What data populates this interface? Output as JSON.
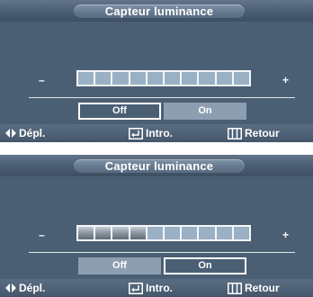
{
  "colors": {
    "panel": "#4b5f74",
    "title_pill": "#66798f",
    "footer": "#4d6075",
    "bar_empty_segment": "#9ab0c4",
    "bar_filled_segment": "#7d8893",
    "unselected_option": "#8c9eb0",
    "text": "#ffffff"
  },
  "menus": [
    {
      "title": "Capteur luminance",
      "minus_label": "–",
      "plus_label": "+",
      "level": {
        "filled_segments": 0,
        "total_segments": 10
      },
      "options": [
        {
          "label": "Off",
          "selected": true
        },
        {
          "label": "On",
          "selected": false
        }
      ],
      "footer": {
        "move": {
          "icon": "left-right-arrows-icon",
          "label": "Dépl."
        },
        "enter": {
          "icon": "enter-key-icon",
          "label": "Intro."
        },
        "back": {
          "icon": "menu-return-icon",
          "label": "Retour"
        }
      }
    },
    {
      "title": "Capteur luminance",
      "minus_label": "–",
      "plus_label": "+",
      "level": {
        "filled_segments": 4,
        "total_segments": 10
      },
      "options": [
        {
          "label": "Off",
          "selected": false
        },
        {
          "label": "On",
          "selected": true
        }
      ],
      "footer": {
        "move": {
          "icon": "left-right-arrows-icon",
          "label": "Dépl."
        },
        "enter": {
          "icon": "enter-key-icon",
          "label": "Intro."
        },
        "back": {
          "icon": "menu-return-icon",
          "label": "Retour"
        }
      }
    }
  ]
}
